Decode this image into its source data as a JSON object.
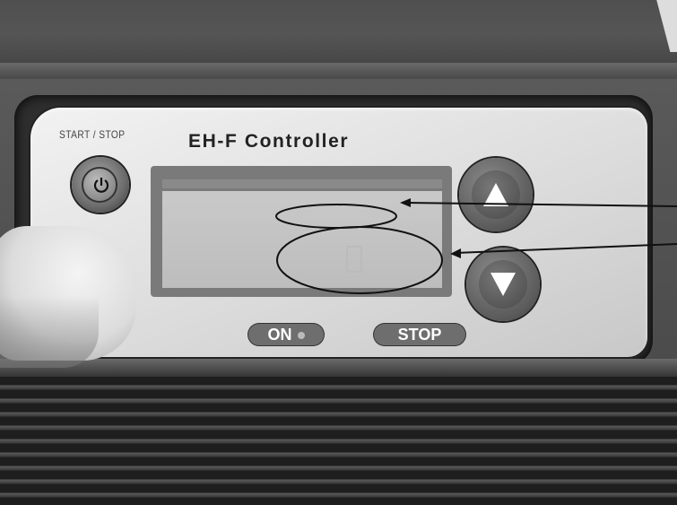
{
  "controller": {
    "title": "EH-F Controller",
    "start_stop_label": "START / STOP",
    "indicator_on_label": "ON",
    "indicator_stop_label": "STOP"
  },
  "icons": {
    "power": "power-icon",
    "up": "up-arrow-icon",
    "down": "down-arrow-icon"
  },
  "colors": {
    "panel": "#e6e6e6",
    "lcd_frame": "#7a7a7a",
    "lcd_screen": "#c4c4c4",
    "pill": "#6e6e6e",
    "housing": "#4a4a4a"
  }
}
